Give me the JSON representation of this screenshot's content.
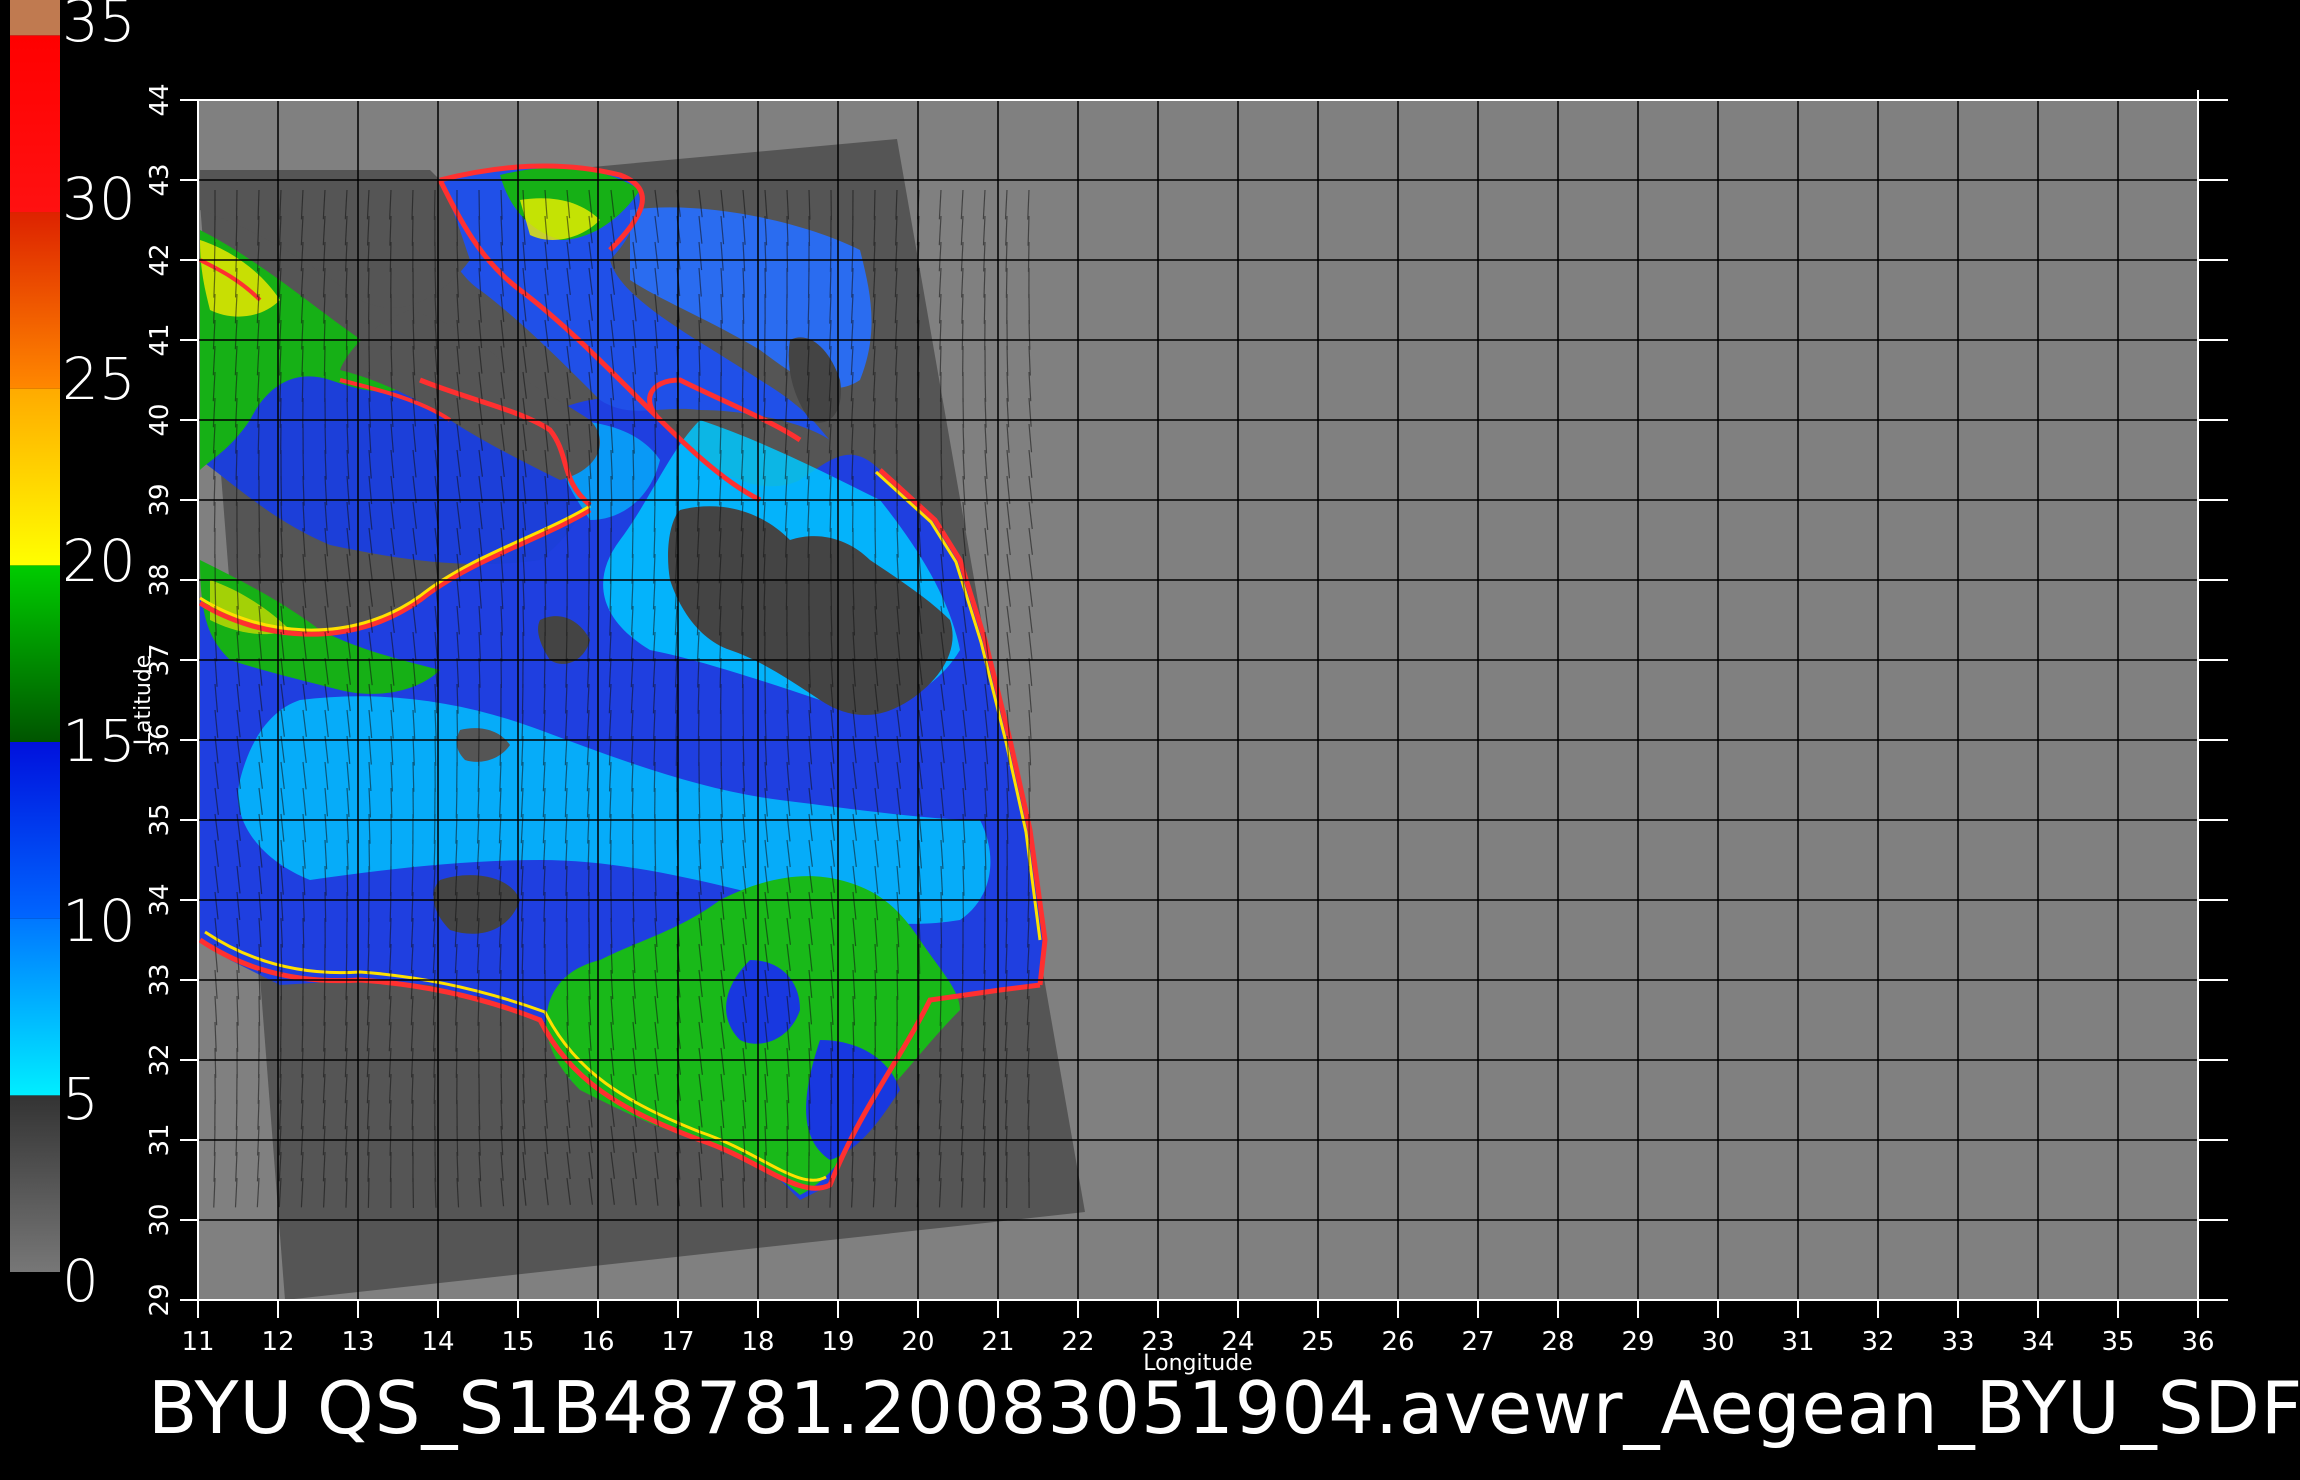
{
  "colorbar": {
    "labels": [
      "35",
      "30",
      "25",
      "20",
      "15",
      "10",
      "5",
      "0"
    ],
    "min": 0,
    "max": 35,
    "segments": [
      {
        "from": 0,
        "to": 5,
        "color": "#777777",
        "color2": "#333333"
      },
      {
        "from": 5,
        "to": 10,
        "color": "#00eeff",
        "color2": "#0077ff"
      },
      {
        "from": 10,
        "to": 15,
        "color": "#0066ff",
        "color2": "#0011dd"
      },
      {
        "from": 15,
        "to": 20,
        "color": "#005500",
        "color2": "#00cc00"
      },
      {
        "from": 20,
        "to": 25,
        "color": "#ffff00",
        "color2": "#ffaa00"
      },
      {
        "from": 25,
        "to": 30,
        "color": "#ff8800",
        "color2": "#dd2200"
      },
      {
        "from": 30,
        "to": 35,
        "color": "#ff1111",
        "color2": "#ff0000"
      },
      {
        "from": 35,
        "to": 36,
        "color": "#c07a50",
        "color2": "#c07a50"
      }
    ]
  },
  "map": {
    "x_axis_label": "Longitude",
    "y_axis_label": "Latitude",
    "lon_ticks": [
      "11",
      "12",
      "13",
      "14",
      "15",
      "16",
      "17",
      "18",
      "19",
      "20",
      "21",
      "22",
      "23",
      "24",
      "25",
      "26",
      "27",
      "28",
      "29",
      "30",
      "31",
      "32",
      "33",
      "34",
      "35",
      "36"
    ],
    "lat_ticks": [
      "29",
      "30",
      "31",
      "32",
      "33",
      "34",
      "35",
      "36",
      "37",
      "38",
      "39",
      "40",
      "41",
      "42",
      "43",
      "44"
    ],
    "lon_range": [
      11,
      36
    ],
    "lat_range": [
      29,
      44
    ],
    "background_color": "#808080",
    "swath_color": "#555555",
    "land_color": "#555555"
  },
  "caption": "BYU  QS_S1B48781.20083051904.avewr_Aegean_BYU_SDF"
}
